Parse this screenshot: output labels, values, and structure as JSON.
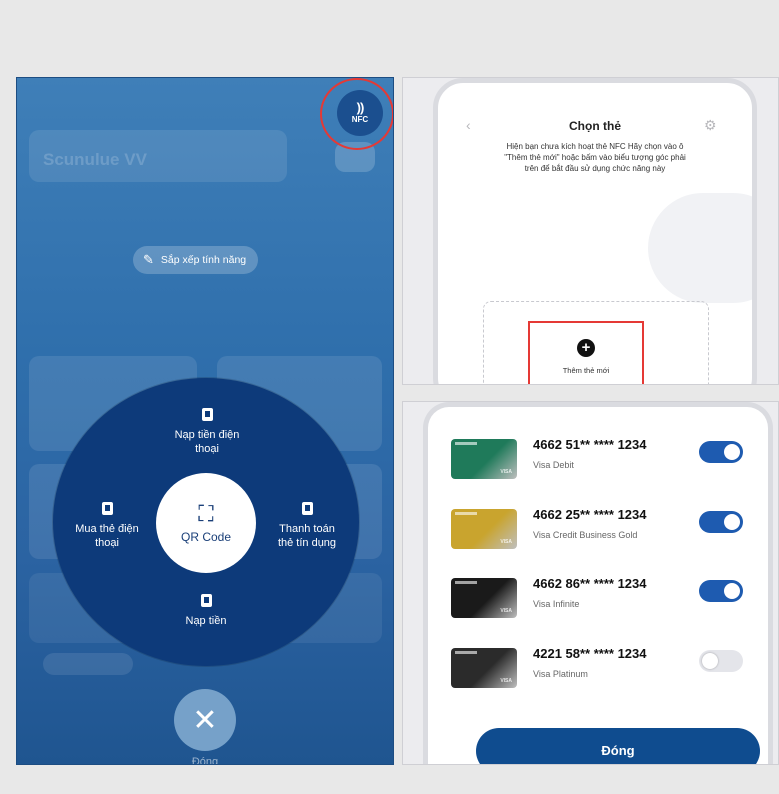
{
  "left": {
    "nfc": {
      "wave": "))",
      "label": "NFC"
    },
    "sort_features_label": "Sắp xếp tính năng",
    "ghost_account_text": "Scunulue VV",
    "menu": {
      "qr_label": "QR Code",
      "topup_phone": [
        "Nạp tiền điện",
        "thoại"
      ],
      "buy_phone_card": [
        "Mua thẻ điện",
        "thoại"
      ],
      "credit_payment": [
        "Thanh toán",
        "thẻ tín dụng"
      ],
      "topup": "Nạp tiền"
    },
    "close_label": "Đóng"
  },
  "choose_card": {
    "title": "Chọn thẻ",
    "description": "Hiện bạn chưa kích hoạt thẻ NFC Hãy chọn vào ô \"Thêm thẻ mới\" hoặc bấm vào biểu tượng góc phải trên để bắt đầu sử dụng chức năng này",
    "add_card_label": "Thêm thẻ mới"
  },
  "cards": [
    {
      "number": "4662 51** **** 1234",
      "type": "Visa Debit",
      "enabled": true,
      "color": "#1f7a5a"
    },
    {
      "number": "4662 25** **** 1234",
      "type": "Visa Credit Business Gold",
      "enabled": true,
      "color": "#c9a42e"
    },
    {
      "number": "4662 86** **** 1234",
      "type": "Visa Infinite",
      "enabled": true,
      "color": "#1a1a1a"
    },
    {
      "number": "4221 58** **** 1234",
      "type": "Visa Platinum",
      "enabled": false,
      "color": "#2b2b2b"
    }
  ],
  "card_brand_mark": "VISA",
  "done_label": "Đóng"
}
